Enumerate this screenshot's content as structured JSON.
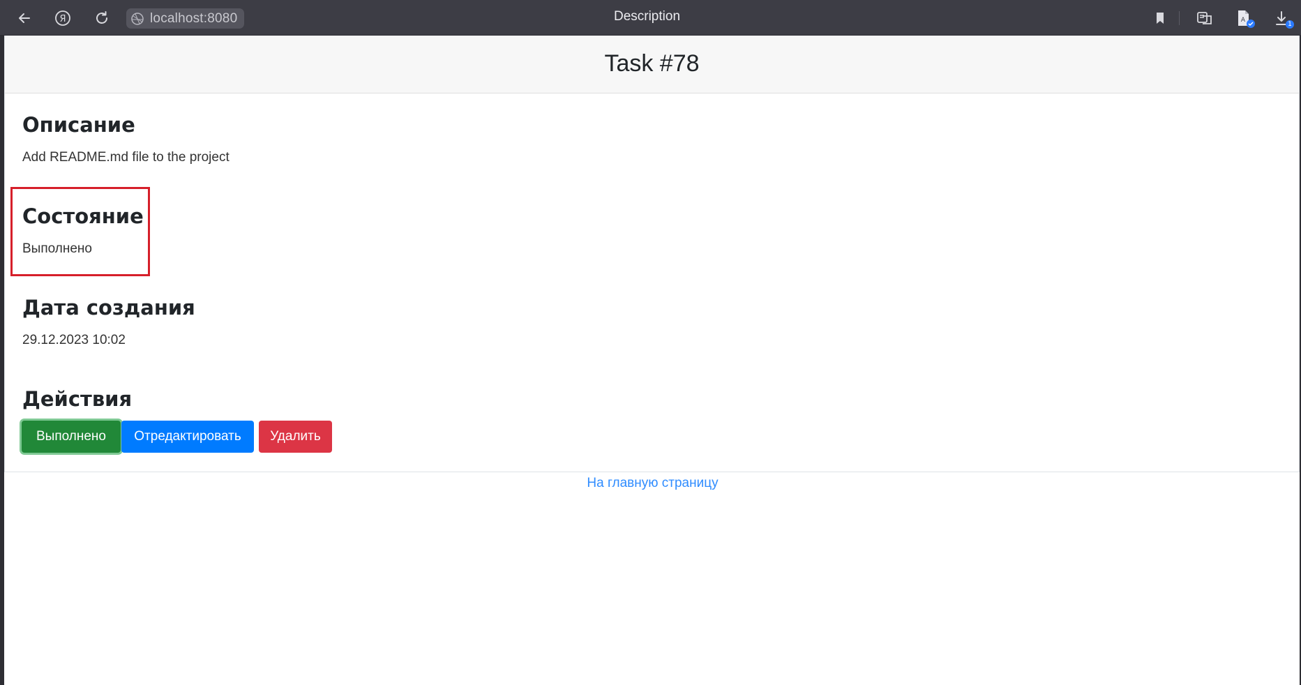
{
  "browser": {
    "address": "localhost:8080",
    "tab_title": "Description",
    "icons": {
      "back": "back-arrow-icon",
      "yandex": "yandex-logo-icon",
      "reload": "reload-icon",
      "site": "site-info-icon",
      "bookmark": "bookmark-icon",
      "reader": "reader-mode-icon",
      "extension": "document-extension-icon",
      "downloads": "downloads-icon"
    },
    "downloads_badge": "1"
  },
  "page": {
    "title": "Task #78",
    "sections": {
      "description": {
        "heading": "Описание",
        "value": "Add README.md file to the project"
      },
      "status": {
        "heading": "Состояние",
        "value": "Выполнено"
      },
      "created": {
        "heading": "Дата создания",
        "value": "29.12.2023 10:02"
      },
      "actions": {
        "heading": "Действия"
      }
    },
    "buttons": {
      "done": "Выполнено",
      "edit": "Отредактировать",
      "delete": "Удалить"
    },
    "home_link": "На главную страницу"
  },
  "colors": {
    "done_button": "#218838",
    "edit_button": "#007bff",
    "delete_button": "#dc3545",
    "highlight": "#d61f2a",
    "link": "#2f8cff"
  }
}
